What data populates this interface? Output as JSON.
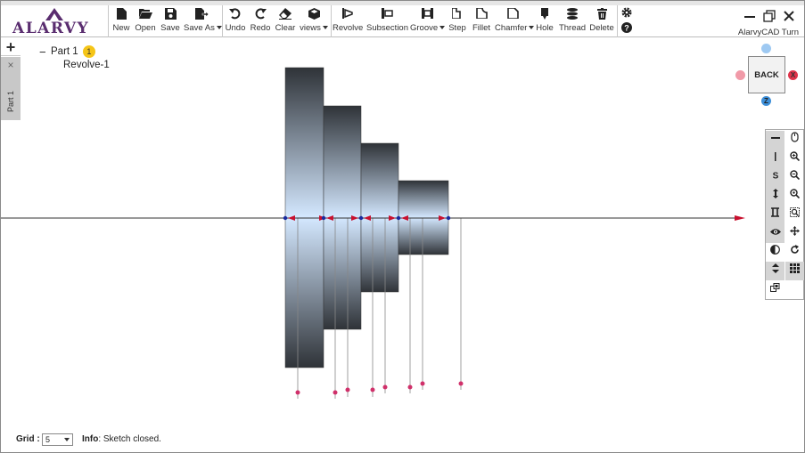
{
  "app": {
    "logo_text": "ALARVY",
    "title": "AlarvyCAD Turn"
  },
  "toolbar": {
    "file": [
      {
        "label": "New",
        "icon": "new-file-icon"
      },
      {
        "label": "Open",
        "icon": "open-folder-icon"
      },
      {
        "label": "Save",
        "icon": "save-icon"
      },
      {
        "label": "Save As",
        "icon": "save-as-icon",
        "dropdown": true
      }
    ],
    "edit": [
      {
        "label": "Undo",
        "icon": "undo-icon"
      },
      {
        "label": "Redo",
        "icon": "redo-icon"
      },
      {
        "label": "Clear",
        "icon": "eraser-icon"
      },
      {
        "label": "views",
        "icon": "cube-icon",
        "dropdown": true
      }
    ],
    "features": [
      {
        "label": "Revolve",
        "icon": "revolve-icon"
      },
      {
        "label": "Subsection",
        "icon": "subsection-icon"
      },
      {
        "label": "Groove",
        "icon": "groove-icon",
        "dropdown": true
      },
      {
        "label": "Step",
        "icon": "step-icon"
      },
      {
        "label": "Fillet",
        "icon": "fillet-icon"
      },
      {
        "label": "Chamfer",
        "icon": "chamfer-icon",
        "dropdown": true
      },
      {
        "label": "Hole",
        "icon": "hole-icon"
      },
      {
        "label": "Thread",
        "icon": "thread-icon"
      },
      {
        "label": "Delete",
        "icon": "trash-icon"
      }
    ]
  },
  "tabs": {
    "add": "+",
    "close": "×",
    "active": "Part 1"
  },
  "tree": {
    "collapse": "−",
    "root": "Part 1",
    "badge": "1",
    "children": [
      "Revolve-1"
    ]
  },
  "viewcube": {
    "face": "BACK",
    "x_axis": "X",
    "z_axis": "Z",
    "colors": {
      "x": "#e0344b",
      "x_neg": "#f19aa8",
      "z": "#3d8fd9",
      "z_neg": "#9ec9f2"
    }
  },
  "right_tools": [
    "horizontal-line-icon",
    "mouse-icon",
    "vertical-line-icon",
    "zoom-in-icon",
    "spline-icon",
    "zoom-out-icon",
    "vertical-arrows-icon",
    "zoom-window-icon",
    "dimension-icon",
    "zoom-fit-icon",
    "eye-icon",
    "pan-icon",
    "contrast-icon",
    "rotate-icon",
    "up-down-icon",
    "grid-icon",
    "export-icon"
  ],
  "footer": {
    "grid_label": "Grid :",
    "grid_value": "5",
    "info_label": "Info",
    "info_text": ": Sketch closed."
  },
  "colors": {
    "accent": "#5a2d6f",
    "arrow": "#c8102e",
    "node": "#1a2aa0",
    "dim_point": "#d0306a"
  }
}
